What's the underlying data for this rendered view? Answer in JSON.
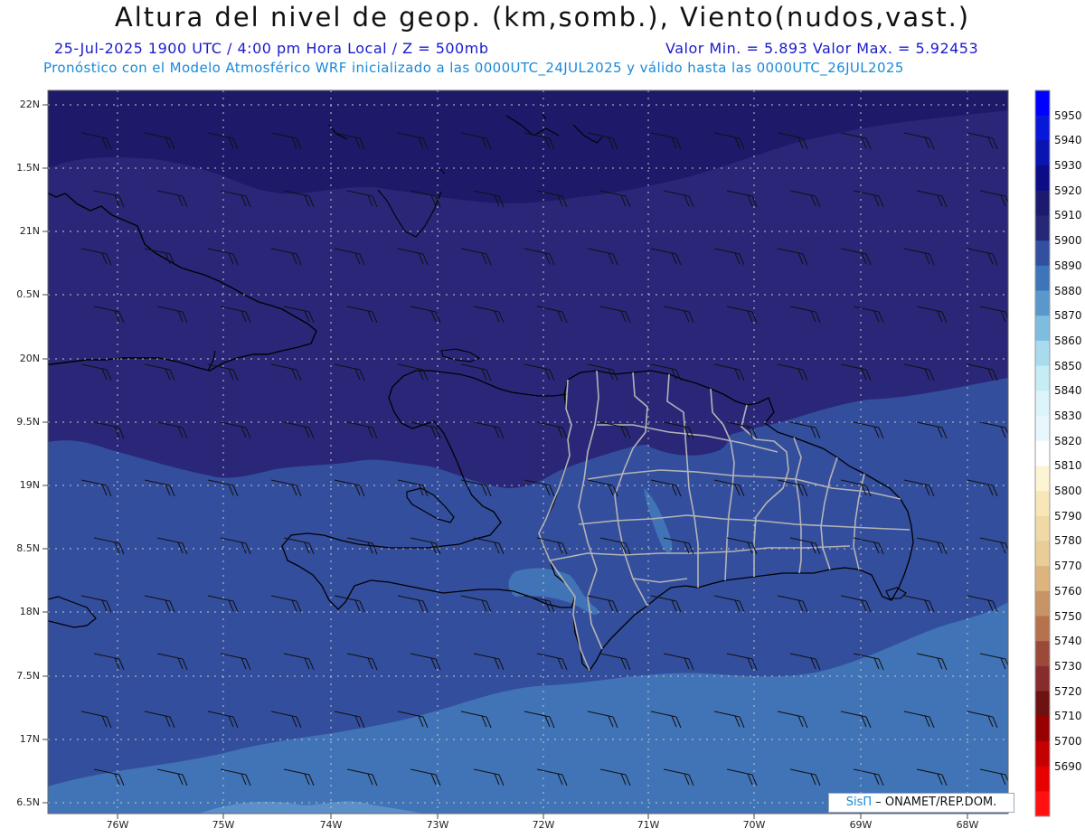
{
  "title": "Altura del nivel de geop. (km,somb.), Viento(nudos,vast.)",
  "subtitle_date": "25-Jul-2025   1900 UTC / 4:00 pm Hora Local / Z = 500mb",
  "subtitle_minmax": "Valor Min. = 5.893  Valor Max. = 5.92453",
  "subtitle_model": "Pronóstico con el Modelo Atmosférico WRF inicializado a las 0000UTC_24JUL2025 y válido hasta las  0000UTC_26JUL2025",
  "lat_labels": [
    "22N",
    "1.5N",
    "21N",
    "0.5N",
    "20N",
    "9.5N",
    "19N",
    "8.5N",
    "18N",
    "7.5N",
    "17N",
    "6.5N"
  ],
  "lon_labels": [
    "76W",
    "75W",
    "74W",
    "73W",
    "72W",
    "71W",
    "70W",
    "69W",
    "68W"
  ],
  "colorbar": {
    "labels": [
      "5950",
      "5940",
      "5930",
      "5920",
      "5910",
      "5900",
      "5890",
      "5880",
      "5870",
      "5860",
      "5850",
      "5840",
      "5830",
      "5820",
      "5810",
      "5800",
      "5790",
      "5780",
      "5770",
      "5760",
      "5750",
      "5740",
      "5730",
      "5720",
      "5710",
      "5700",
      "5690"
    ],
    "colors": [
      "#0000ff",
      "#0818d8",
      "#0a14b0",
      "#0c0c86",
      "#1b1a6e",
      "#262777",
      "#334fa0",
      "#3d75b8",
      "#5a98cc",
      "#7fbde0",
      "#a8dbee",
      "#c6ecf4",
      "#ddf4fa",
      "#e8f7fd",
      "#ffffff",
      "#fdf4d3",
      "#f7e7b8",
      "#f0d9a6",
      "#e9cc98",
      "#ddb47e",
      "#c89366",
      "#b5724d",
      "#9b4a3a",
      "#872b2c",
      "#6e1111",
      "#990000",
      "#c40000",
      "#e60000",
      "#ff1111"
    ]
  },
  "credit": {
    "logo": "SisΠ",
    "text": " – ONAMET/REP.DOM."
  },
  "colors": {
    "band_5920": "#1d1a6a",
    "band_5910": "#2a2779",
    "band_5900": "#334e9d",
    "band_5890": "#4174b6",
    "band_5880": "#5c8fc8",
    "coast": "#000000",
    "provinces": "#b4b4b4"
  }
}
